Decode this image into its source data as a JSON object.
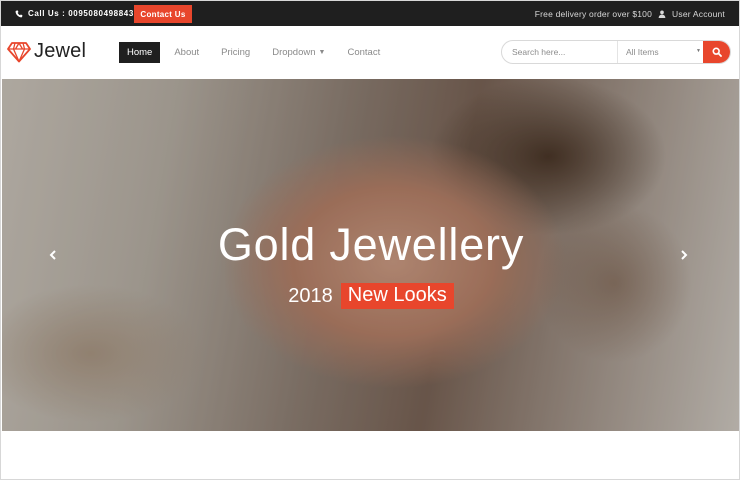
{
  "topbar": {
    "phone_label": "Call Us : 00950804988436",
    "contact_button": "Contact Us",
    "delivery_text": "Free delivery order over $100",
    "account_label": "User Account"
  },
  "brand": {
    "name": "Jewel",
    "accent_color": "#e8462c"
  },
  "nav": {
    "items": [
      {
        "label": "Home",
        "active": true
      },
      {
        "label": "About"
      },
      {
        "label": "Pricing"
      },
      {
        "label": "Dropdown",
        "has_caret": true
      },
      {
        "label": "Contact"
      }
    ]
  },
  "search": {
    "placeholder": "Search here...",
    "category_selected": "All Items",
    "button_icon": "search-icon"
  },
  "hero": {
    "title": "Gold Jewellery",
    "year": "2018",
    "badge": "New Looks",
    "prev_icon": "chevron-left-icon",
    "next_icon": "chevron-right-icon"
  },
  "colors": {
    "topbar_bg": "#1f1f1f",
    "accent": "#e8462c",
    "nav_text": "#8a8a8a"
  }
}
